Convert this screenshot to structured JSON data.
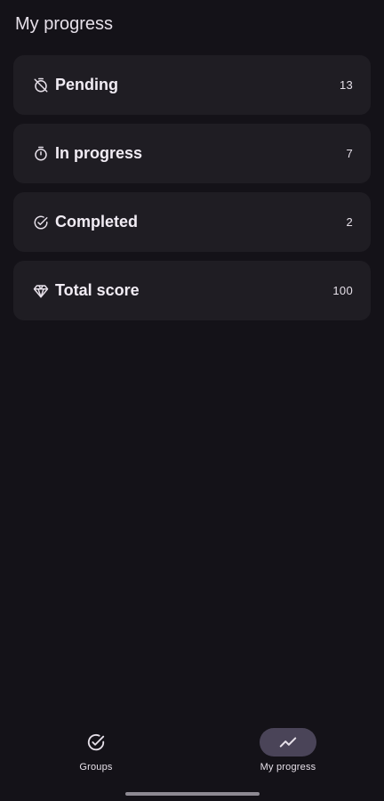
{
  "header": {
    "title": "My progress"
  },
  "stats": [
    {
      "label": "Pending",
      "value": "13",
      "icon": "timer-off-icon"
    },
    {
      "label": "In progress",
      "value": "7",
      "icon": "timer-icon"
    },
    {
      "label": "Completed",
      "value": "2",
      "icon": "check-circle-icon"
    },
    {
      "label": "Total score",
      "value": "100",
      "icon": "diamond-icon"
    }
  ],
  "nav": {
    "items": [
      {
        "label": "Groups",
        "icon": "check-circle-icon",
        "active": false
      },
      {
        "label": "My progress",
        "icon": "trending-up-icon",
        "active": true
      }
    ]
  },
  "colors": {
    "background": "#141218",
    "card": "#1f1d23",
    "active_pill": "#4a4458"
  }
}
